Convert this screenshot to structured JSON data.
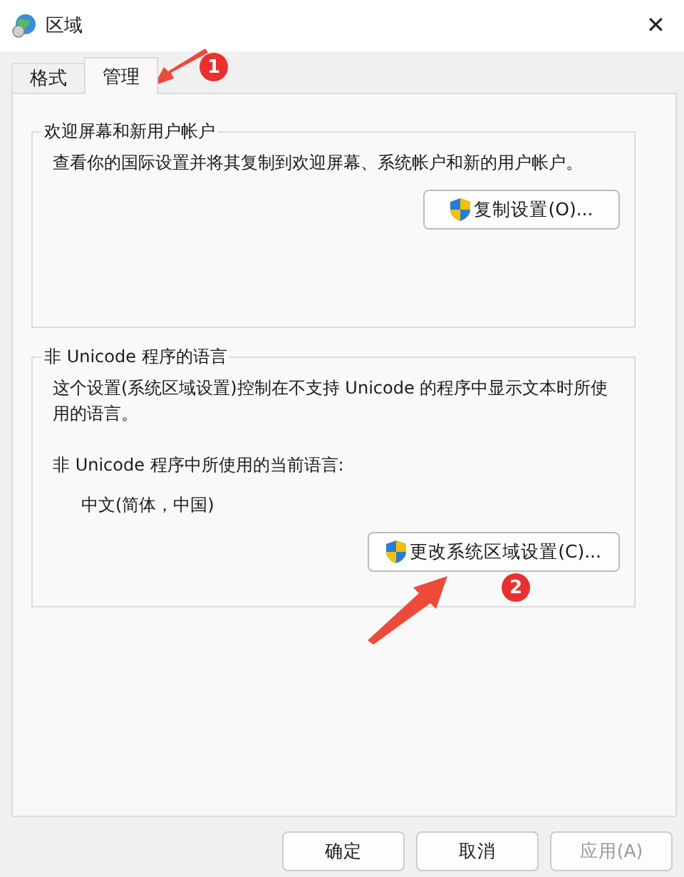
{
  "window": {
    "title": "区域",
    "close": "✕"
  },
  "tabs": [
    {
      "label": "格式",
      "selected": false
    },
    {
      "label": "管理",
      "selected": true
    }
  ],
  "groups": [
    {
      "title": "欢迎屏幕和新用户帐户",
      "lines": [
        {
          "kind": "text",
          "text": "查看你的国际设置并将其复制到欢迎屏幕、系统帐户和新的用户帐户。"
        }
      ],
      "button": "复制设置(O)..."
    },
    {
      "title": "非 Unicode 程序的语言",
      "lines": [
        {
          "kind": "text",
          "text": "这个设置(系统区域设置)控制在不支持 Unicode 的程序中显示文本时所使用的语言。"
        },
        {
          "kind": "label",
          "text": "非 Unicode 程序中所使用的当前语言:"
        },
        {
          "kind": "value",
          "text": "中文(简体，中国)"
        }
      ],
      "button": "更改系统区域设置(C)..."
    }
  ],
  "annotations": [
    {
      "number": "1"
    },
    {
      "number": "2"
    }
  ],
  "buttons": [
    {
      "label": "确定",
      "disabled": false
    },
    {
      "label": "取消",
      "disabled": false
    },
    {
      "label": "应用(A)",
      "disabled": true
    }
  ]
}
